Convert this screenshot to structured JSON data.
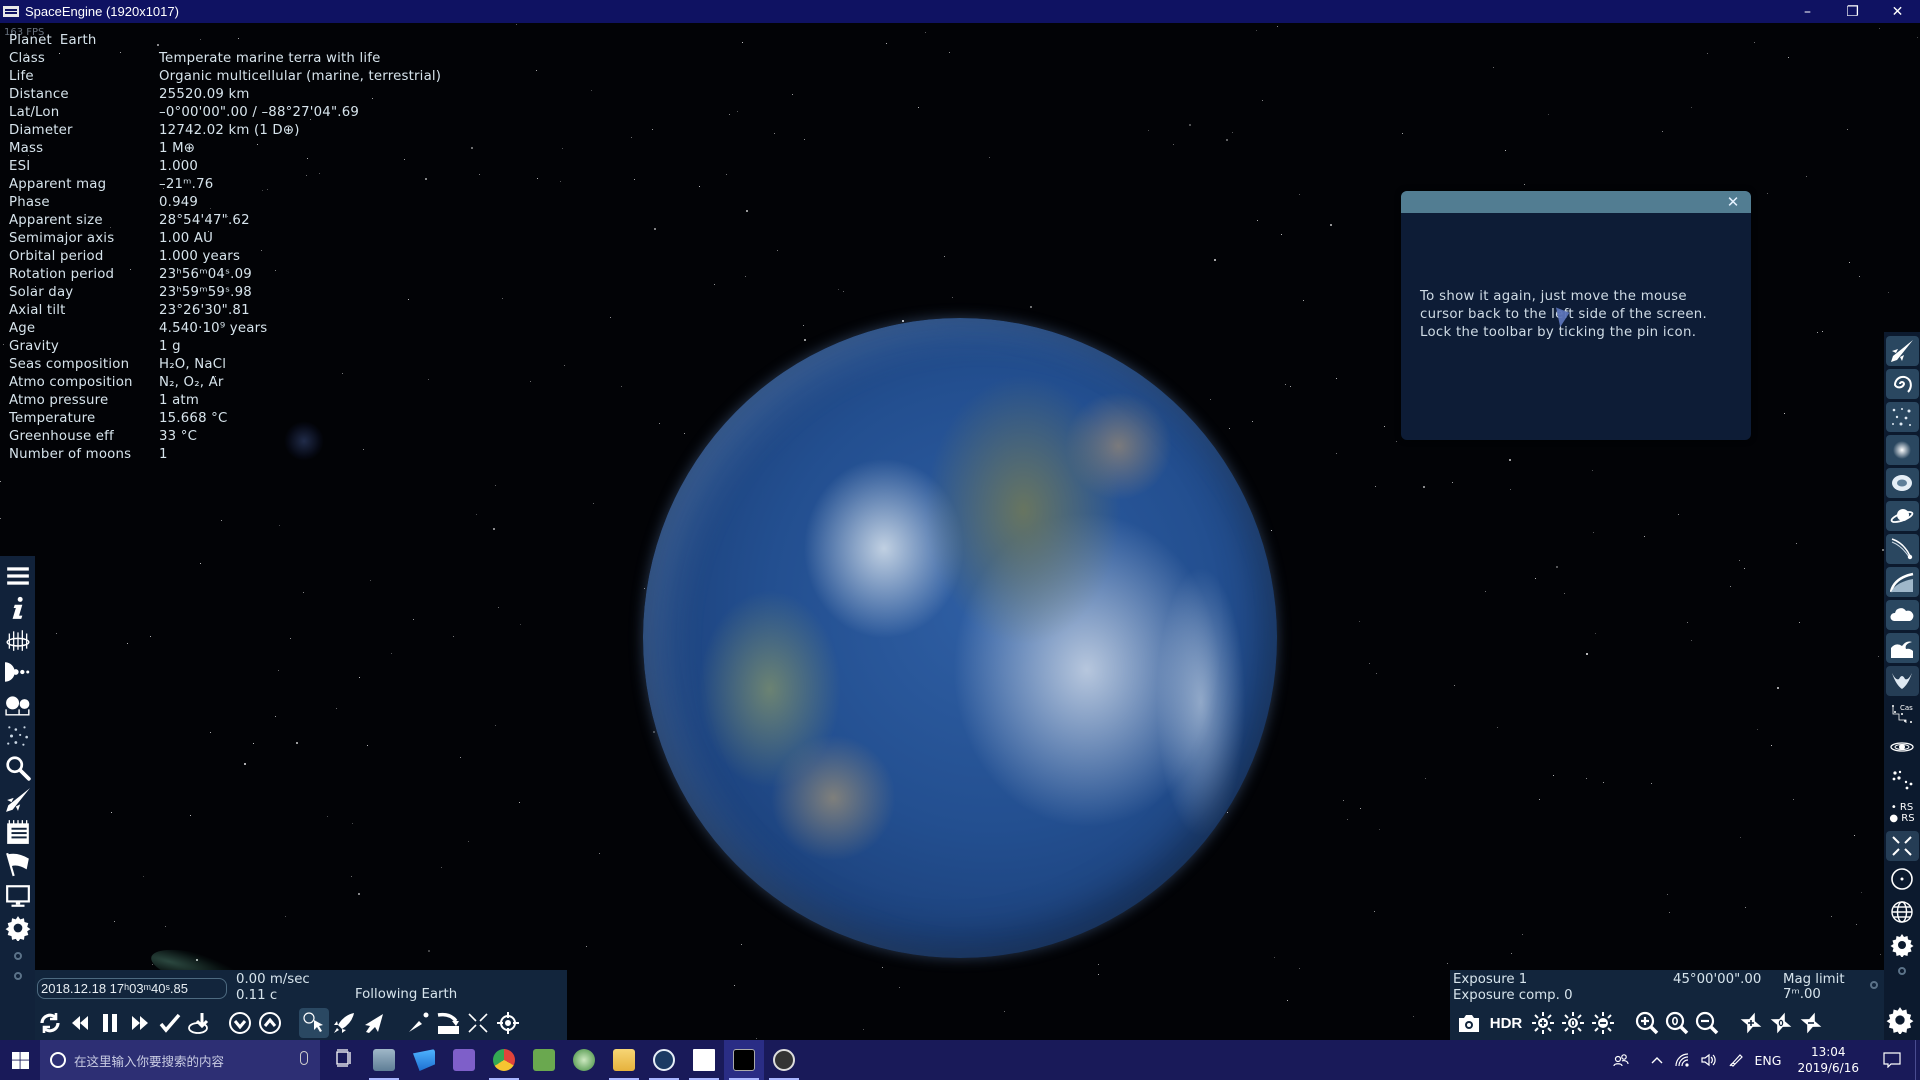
{
  "window": {
    "title": "SpaceEngine (1920x1017)",
    "controls": {
      "minimize": "–",
      "restore": "❐",
      "close": "✕"
    }
  },
  "overlay": {
    "fps": "163 FPS",
    "object_type": "Planet",
    "object_name": "Earth",
    "properties": [
      {
        "label": "Class",
        "value": "Temperate marine terra with life"
      },
      {
        "label": "Life",
        "value": "Organic multicellular (marine, terrestrial)"
      },
      {
        "label": "Distance",
        "value": "25520.09 km"
      },
      {
        "label": "Lat/Lon",
        "value": "–0°00'00\".00 / –88°27'04\".69"
      },
      {
        "label": "Diameter",
        "value": "12742.02 km (1 D⊕)"
      },
      {
        "label": "Mass",
        "value": "1 M⊕"
      },
      {
        "label": "ESI",
        "value": "1.000"
      },
      {
        "label": "Apparent mag",
        "value": "–21ᵐ.76"
      },
      {
        "label": "Phase",
        "value": "0.949"
      },
      {
        "label": "Apparent size",
        "value": "28°54'47\".62"
      },
      {
        "label": "Semimajor axis",
        "value": "1.00 AU"
      },
      {
        "label": "Orbital period",
        "value": "1.000 years"
      },
      {
        "label": "Rotation period",
        "value": "23ʰ56ᵐ04ˢ.09"
      },
      {
        "label": "Solar day",
        "value": "23ʰ59ᵐ59ˢ.98"
      },
      {
        "label": "Axial tilt",
        "value": "23°26'30\".81"
      },
      {
        "label": "Age",
        "value": "4.540·10⁹ years"
      },
      {
        "label": "Gravity",
        "value": "1 g"
      },
      {
        "label": "Seas composition",
        "value": "H₂O, NaCl"
      },
      {
        "label": "Atmo composition",
        "value": "N₂, O₂, Ar"
      },
      {
        "label": "Atmo pressure",
        "value": "1 atm"
      },
      {
        "label": "Temperature",
        "value": "15.668 °C"
      },
      {
        "label": "Greenhouse eff",
        "value": "33 °C"
      },
      {
        "label": "Number of moons",
        "value": "1"
      }
    ]
  },
  "hint_dialog": {
    "text": "To show it again, just move the mouse cursor back to the left side of the screen. Lock the toolbar by ticking the pin icon.",
    "close_icon": "close-icon"
  },
  "left_toolbar": {
    "items": [
      {
        "name": "menu",
        "icon": "hamburger-menu-icon"
      },
      {
        "name": "info",
        "icon": "info-icon"
      },
      {
        "name": "star-browser",
        "icon": "system-browser-icon"
      },
      {
        "name": "solar-system",
        "icon": "planetary-system-icon"
      },
      {
        "name": "wiki",
        "icon": "object-compare-icon"
      },
      {
        "name": "star-map",
        "icon": "star-field-icon"
      },
      {
        "name": "find",
        "icon": "search-icon"
      },
      {
        "name": "ship",
        "icon": "spaceship-icon"
      },
      {
        "name": "journal",
        "icon": "notepad-icon"
      },
      {
        "name": "flag",
        "icon": "flag-icon"
      },
      {
        "name": "display",
        "icon": "monitor-icon"
      },
      {
        "name": "settings",
        "icon": "gear-icon"
      }
    ]
  },
  "right_toolbar": {
    "items": [
      {
        "name": "spacecraft",
        "icon": "spaceship-icon"
      },
      {
        "name": "galaxies",
        "icon": "galaxy-icon"
      },
      {
        "name": "stars",
        "icon": "stars-icon"
      },
      {
        "name": "clusters",
        "icon": "star-cluster-icon"
      },
      {
        "name": "nebulae",
        "icon": "nebula-icon"
      },
      {
        "name": "planets",
        "icon": "ringed-planet-icon"
      },
      {
        "name": "comets",
        "icon": "comet-icon"
      },
      {
        "name": "atmospheres",
        "icon": "atmosphere-icon"
      },
      {
        "name": "clouds",
        "icon": "cloud-icon"
      },
      {
        "name": "water",
        "icon": "wave-icon"
      },
      {
        "name": "aurora",
        "icon": "aurora-icon"
      },
      {
        "name": "constellations",
        "icon": "constellation-icon",
        "label": "Cas"
      },
      {
        "name": "orbits",
        "icon": "orbit-icon"
      },
      {
        "name": "markers",
        "icon": "markers-icon"
      },
      {
        "name": "labels",
        "icon": "labels-icon",
        "label": "RS"
      },
      {
        "name": "fullscreen",
        "icon": "collapse-icon"
      },
      {
        "name": "center",
        "icon": "target-circle-icon"
      },
      {
        "name": "grid",
        "icon": "globe-grid-icon"
      },
      {
        "name": "settings",
        "icon": "gear-icon"
      }
    ]
  },
  "bottom_left": {
    "datetime": "2018.12.18 17ʰ03ᵐ40ˢ.85",
    "speed": "0.00 m/sec",
    "speed_c": "0.11 c",
    "status": "Following Earth",
    "buttons": [
      {
        "name": "reverse-time",
        "icon": "sync-icon"
      },
      {
        "name": "slower",
        "icon": "rewind-icon"
      },
      {
        "name": "pause",
        "icon": "pause-icon"
      },
      {
        "name": "faster",
        "icon": "fast-forward-icon"
      },
      {
        "name": "real-time",
        "icon": "check-icon"
      },
      {
        "name": "set-time",
        "icon": "clock-down-icon"
      },
      {
        "name": "speed-down",
        "icon": "circle-chevron-down-icon"
      },
      {
        "name": "speed-up",
        "icon": "circle-chevron-up-icon"
      },
      {
        "name": "free-mode",
        "icon": "globe-cursor-icon"
      },
      {
        "name": "spaceship-mode",
        "icon": "rocket-icon"
      },
      {
        "name": "aircraft-mode",
        "icon": "airplane-icon"
      },
      {
        "name": "go-to",
        "icon": "go-to-icon"
      },
      {
        "name": "land",
        "icon": "land-icon"
      },
      {
        "name": "free-camera",
        "icon": "scatter-arrows-icon"
      },
      {
        "name": "center-object",
        "icon": "crosshair-icon"
      }
    ]
  },
  "bottom_right": {
    "exposure": "Exposure 1",
    "exposure_comp": "Exposure comp. 0",
    "fov": "45°00'00\".00",
    "mag_limit": "Mag limit 7ᵐ.00",
    "hdr_label": "HDR",
    "buttons": [
      {
        "name": "screenshot",
        "icon": "camera-icon"
      },
      {
        "name": "hdr",
        "icon": "hdr-text"
      },
      {
        "name": "exposure-up",
        "icon": "sun-plus-icon"
      },
      {
        "name": "exposure-reset",
        "icon": "sun-zero-icon"
      },
      {
        "name": "exposure-down",
        "icon": "sun-minus-icon"
      },
      {
        "name": "zoom-in",
        "icon": "zoom-in-icon"
      },
      {
        "name": "zoom-reset",
        "icon": "zoom-zero-icon"
      },
      {
        "name": "zoom-out",
        "icon": "zoom-out-icon"
      },
      {
        "name": "mag-limit-up",
        "icon": "star-plus-icon"
      },
      {
        "name": "mag-limit-reset",
        "icon": "star-zero-icon"
      },
      {
        "name": "mag-limit-down",
        "icon": "star-minus-icon"
      },
      {
        "name": "settings",
        "icon": "gear-icon"
      }
    ]
  },
  "taskbar": {
    "search_placeholder": "在这里输入你要搜索的内容",
    "apps": [
      {
        "name": "task-view",
        "icon": "task-view-icon"
      },
      {
        "name": "resource-monitor",
        "icon": "monitor-chart-icon",
        "active": false,
        "running": true
      },
      {
        "name": "remote-desktop",
        "icon": "remote-desktop-icon",
        "active": false,
        "running": false
      },
      {
        "name": "visual-studio",
        "icon": "visual-studio-icon",
        "active": false,
        "running": false
      },
      {
        "name": "chrome",
        "icon": "chrome-icon",
        "active": false,
        "running": true
      },
      {
        "name": "hardware",
        "icon": "network-card-icon",
        "active": false,
        "running": false
      },
      {
        "name": "xbox-tool",
        "icon": "xbox-icon",
        "active": false,
        "running": false
      },
      {
        "name": "file-explorer",
        "icon": "folder-icon",
        "active": false,
        "running": true
      },
      {
        "name": "steam",
        "icon": "steam-icon",
        "active": false,
        "running": true
      },
      {
        "name": "calculator",
        "icon": "calculator-icon",
        "active": false,
        "running": true
      },
      {
        "name": "spaceengine",
        "icon": "spaceengine-icon",
        "active": true,
        "running": true
      },
      {
        "name": "obs",
        "icon": "obs-icon",
        "active": false,
        "running": true
      }
    ],
    "tray": {
      "language": "ENG",
      "time": "13:04",
      "date": "2019/6/16"
    }
  }
}
